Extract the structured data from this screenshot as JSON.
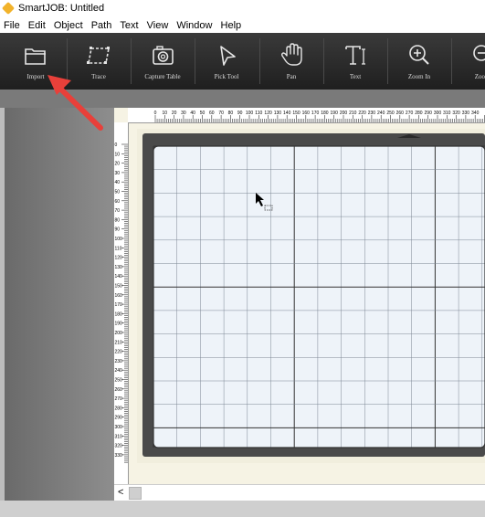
{
  "window": {
    "title": "SmartJOB: Untitled"
  },
  "menu": [
    "File",
    "Edit",
    "Object",
    "Path",
    "Text",
    "View",
    "Window",
    "Help"
  ],
  "toolbar": {
    "tools": [
      {
        "label": "Import",
        "icon": "folder-open-icon"
      },
      {
        "label": "Trace",
        "icon": "trace-icon"
      },
      {
        "label": "Capture Table",
        "icon": "camera-icon"
      },
      {
        "label": "Pick Tool",
        "icon": "pointer-icon"
      },
      {
        "label": "Pan",
        "icon": "hand-icon"
      },
      {
        "label": "Text",
        "icon": "text-tool-icon"
      },
      {
        "label": "Zoom In",
        "icon": "zoom-in-icon"
      },
      {
        "label": "Zoo",
        "icon": "zoom-out-icon"
      }
    ]
  },
  "rulers": {
    "horizontal": [
      "0",
      "10",
      "20",
      "30",
      "40",
      "50",
      "60",
      "70",
      "80",
      "90",
      "100",
      "110",
      "120",
      "130",
      "140",
      "150",
      "160",
      "170",
      "180",
      "190",
      "200",
      "210",
      "220",
      "230",
      "240",
      "250",
      "260",
      "270",
      "280",
      "290",
      "300",
      "310",
      "320",
      "330",
      "340",
      "350"
    ],
    "vertical": [
      "0",
      "10",
      "20",
      "30",
      "40",
      "50",
      "60",
      "70",
      "80",
      "90",
      "100",
      "110",
      "120",
      "130",
      "140",
      "150",
      "160",
      "170",
      "180",
      "190",
      "200",
      "210",
      "220",
      "230",
      "240",
      "250",
      "260",
      "270",
      "280",
      "290",
      "300",
      "310",
      "320",
      "330"
    ]
  },
  "colors": {
    "toolbar": "#2b2b2b",
    "arrow": "#e8403a",
    "grid_bg": "#eef3f9",
    "frame": "#4a4a4a",
    "workspace": "#f6f3e4"
  },
  "scrollbar": {
    "left_glyph": "<"
  }
}
